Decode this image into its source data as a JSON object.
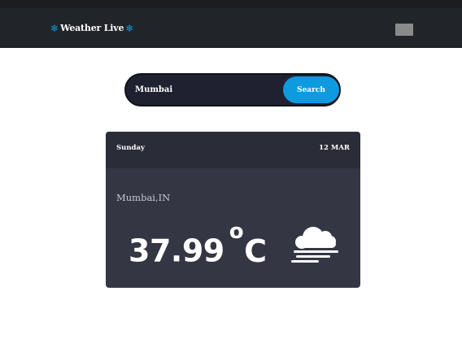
{
  "navbar": {
    "brand": "Weather Live",
    "icon_left": "snowflake-icon",
    "icon_right": "snowflake-icon",
    "menu_icon": "menu-toggle-icon"
  },
  "search": {
    "value": "Mumbai",
    "button_label": "Search"
  },
  "card": {
    "day": "Sunday",
    "date": "12 MAR",
    "location": "Mumbai,IN",
    "temperature": "37.99",
    "degree_symbol": "o",
    "unit": "C",
    "condition_icon": "cloud-fog-icon"
  },
  "colors": {
    "navbar": "#212529",
    "accent": "#0d9adf",
    "card": "#343644",
    "card_header": "#2a2c38"
  }
}
